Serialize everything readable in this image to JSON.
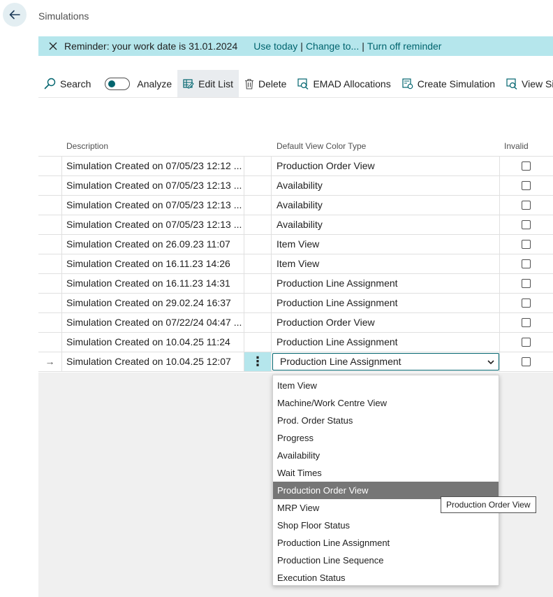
{
  "header": {
    "back_icon": "arrow-left-icon",
    "title": "Simulations"
  },
  "reminder": {
    "text": "Reminder: your work date is 31.01.2024",
    "use_today": "Use today",
    "change_to": "Change to...",
    "turn_off": "Turn off reminder",
    "separator": "|",
    "bg_color": "#b5e6ec",
    "link_color": "#00646e"
  },
  "toolbar": {
    "search": "Search",
    "analyze": "Analyze",
    "edit_list": "Edit List",
    "delete": "Delete",
    "emad_allocations": "EMAD Allocations",
    "create_simulation": "Create Simulation",
    "view_simulation": "View Sim"
  },
  "grid": {
    "columns": {
      "description": "Description",
      "type": "Default View Color Type",
      "invalid": "Invalid"
    },
    "rows": [
      {
        "description": "Simulation Created on 07/05/23 12:12 ...",
        "type": "Production Order View"
      },
      {
        "description": "Simulation Created on 07/05/23 12:13 ...",
        "type": "Availability"
      },
      {
        "description": "Simulation Created on 07/05/23 12:13 ...",
        "type": "Availability"
      },
      {
        "description": "Simulation Created on 07/05/23 12:13 ...",
        "type": "Availability"
      },
      {
        "description": "Simulation Created on 26.09.23 11:07",
        "type": "Item View"
      },
      {
        "description": "Simulation Created on 16.11.23 14:26",
        "type": "Item View"
      },
      {
        "description": "Simulation Created on 16.11.23 14:31",
        "type": "Production Line Assignment"
      },
      {
        "description": "Simulation Created on 29.02.24 16:37",
        "type": "Production Line Assignment"
      },
      {
        "description": "Simulation Created on 07/22/24 04:47 ...",
        "type": "Production Order View"
      },
      {
        "description": "Simulation Created on 10.04.25 11:24",
        "type": "Production Line Assignment"
      }
    ],
    "selected_row": {
      "marker": "→",
      "description": "Simulation Created on 10.04.25 12:07",
      "menu_glyph": "⋮",
      "type": "Production Line Assignment"
    }
  },
  "dropdown": {
    "options": [
      "Item View",
      "Machine/Work Centre View",
      "Prod. Order Status",
      "Progress",
      "Availability",
      "Wait Times",
      "Production Order View",
      "MRP View",
      "Shop Floor Status",
      "Production Line Assignment",
      "Production Line Sequence",
      "Execution Status"
    ],
    "highlighted": "Production Order View"
  },
  "tooltip": {
    "text": "Production Order View"
  }
}
